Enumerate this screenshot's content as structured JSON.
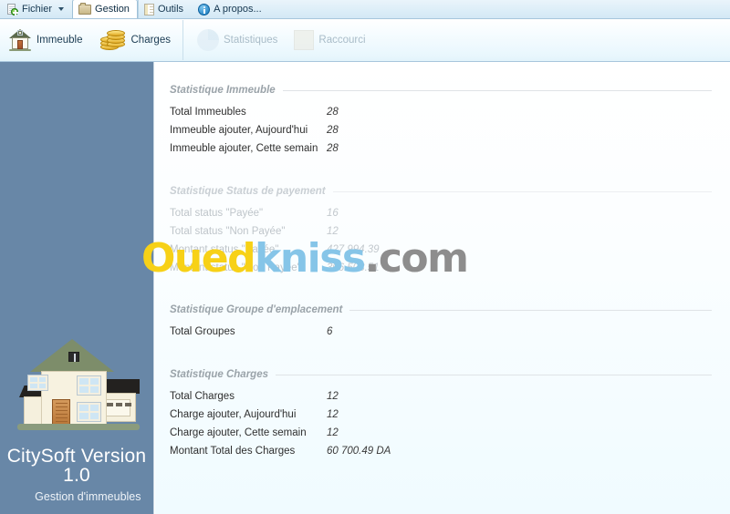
{
  "tabs": [
    {
      "label": "Fichier",
      "icon": "file-add-icon",
      "active": false,
      "caret": true
    },
    {
      "label": "Gestion",
      "icon": "folder-icon",
      "active": true,
      "caret": false
    },
    {
      "label": "Outils",
      "icon": "tools-icon",
      "active": false,
      "caret": false
    },
    {
      "label": "A propos...",
      "icon": "info-icon",
      "active": false,
      "caret": false
    }
  ],
  "ribbon": {
    "buttons": [
      {
        "label": "Immeuble",
        "icon": "house-icon",
        "disabled": false
      },
      {
        "label": "Charges",
        "icon": "coins-icon",
        "disabled": false
      },
      {
        "label": "Statistiques",
        "icon": "pie-chart-icon",
        "disabled": true
      },
      {
        "label": "Raccourci",
        "icon": "shortcut-icon",
        "disabled": true
      }
    ]
  },
  "sidebar": {
    "title": "CitySoft Version 1.0",
    "subtitle": "Gestion d'immeubles",
    "background": "#6887a7",
    "logo": "house-illustration"
  },
  "watermark": {
    "part1": "Oued",
    "part2": "kniss",
    "part3": ".com",
    "color1": "#f7d117",
    "color2": "#86c5e8",
    "color3": "#8d8d8d"
  },
  "sections": [
    {
      "id": "immeuble",
      "title": "Statistique Immeuble",
      "faded": false,
      "rows": [
        {
          "label": "Total Immeubles",
          "value": "28"
        },
        {
          "label": "Immeuble ajouter, Aujourd'hui",
          "value": "28"
        },
        {
          "label": "Immeuble ajouter, Cette semain",
          "value": "28"
        }
      ]
    },
    {
      "id": "payement",
      "title": "Statistique Status de payement",
      "faded": true,
      "rows": [
        {
          "label": "Total status \"Payée\"",
          "value": "16"
        },
        {
          "label": "Total status \"Non Payée\"",
          "value": "12"
        },
        {
          "label": "Montant status \"Payée\"",
          "value": "427 994.39"
        },
        {
          "label": "Montant status \"Non Payée\"",
          "value": "306 503.51"
        }
      ]
    },
    {
      "id": "groupe",
      "title": "Statistique Groupe d'emplacement",
      "faded": false,
      "rows": [
        {
          "label": "Total Groupes",
          "value": "6"
        }
      ]
    },
    {
      "id": "charges",
      "title": "Statistique Charges",
      "faded": false,
      "rows": [
        {
          "label": "Total Charges",
          "value": "12"
        },
        {
          "label": "Charge ajouter, Aujourd'hui",
          "value": "12"
        },
        {
          "label": "Charge ajouter, Cette semain",
          "value": "12"
        },
        {
          "label": "Montant Total des Charges",
          "value": "60 700.49 DA"
        }
      ]
    }
  ]
}
